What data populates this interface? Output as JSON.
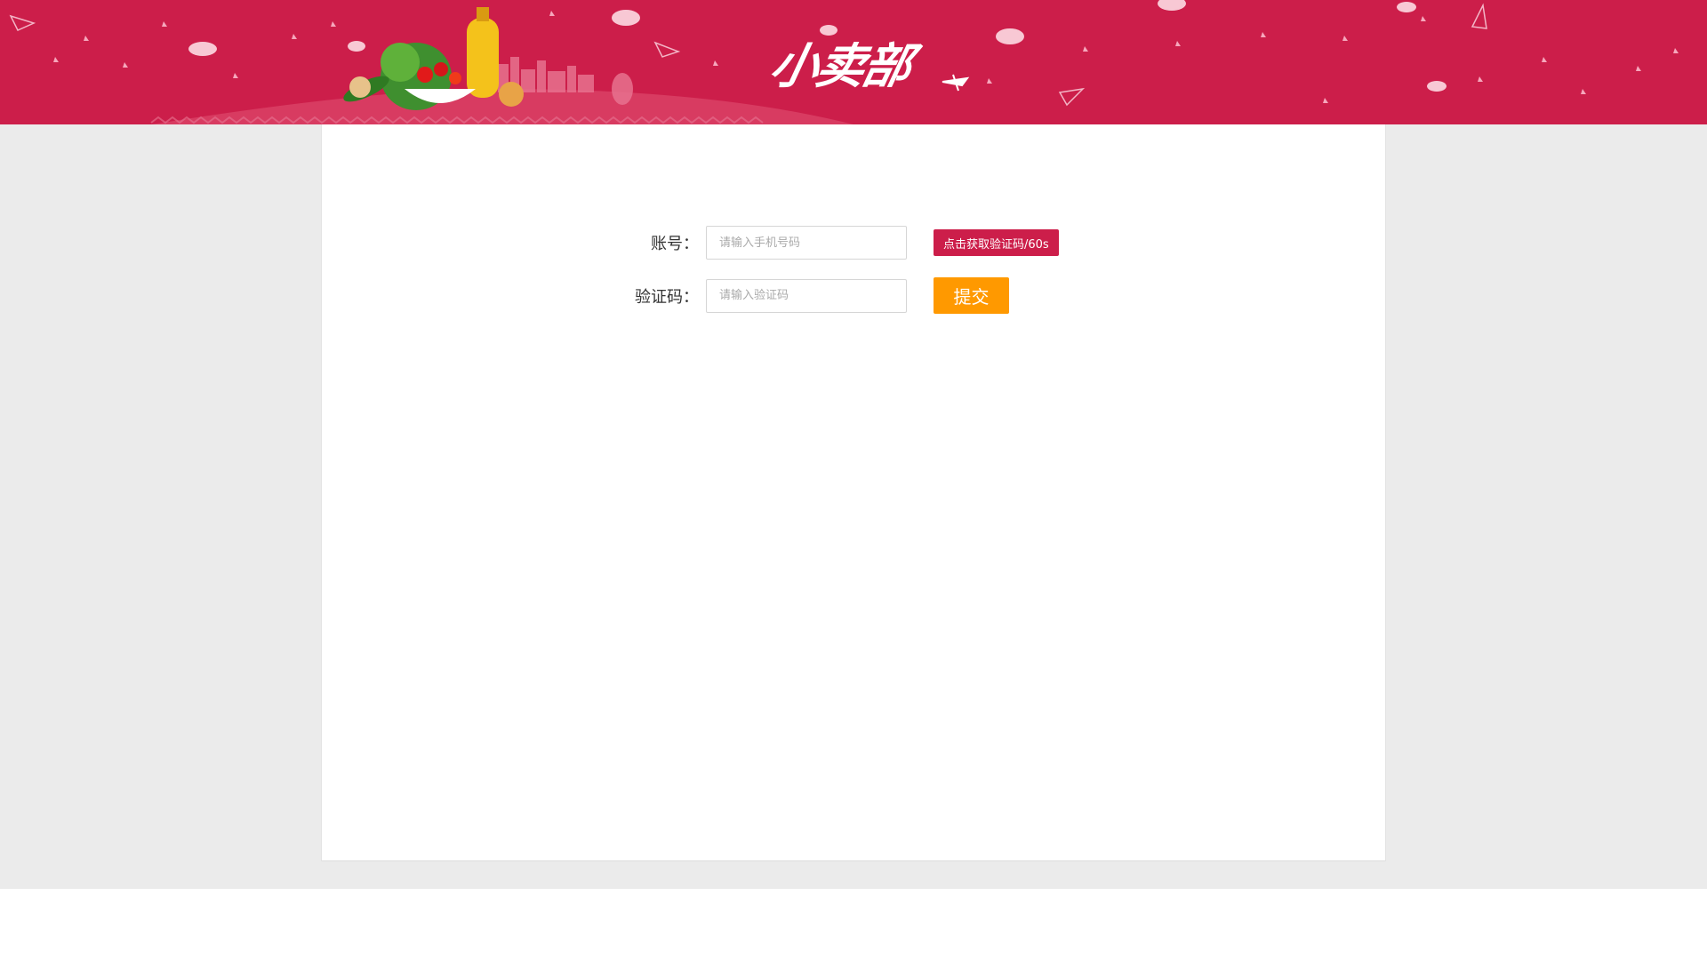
{
  "header": {
    "logo_text": "小卖部",
    "brand_color": "#cc1e4a",
    "decor_icons": [
      "paper-plane-icon",
      "cloud-icon",
      "airplane-icon",
      "vegetables-illustration",
      "city-skyline-illustration"
    ]
  },
  "form": {
    "account_label": "账号：",
    "account_placeholder": "请输入手机号码",
    "account_value": "",
    "code_label": "验证码：",
    "code_placeholder": "请输入验证码",
    "code_value": "",
    "get_code_button": "点击获取验证码/60s",
    "submit_button": "提交",
    "submit_color": "#ff9900"
  },
  "colors": {
    "page_background": "#ebebeb",
    "panel_background": "#ffffff"
  }
}
